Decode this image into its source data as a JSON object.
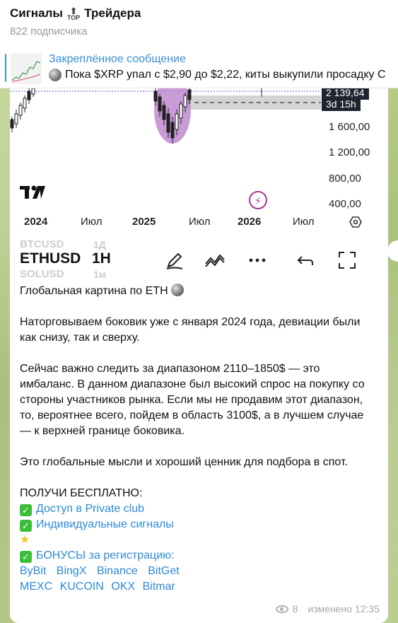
{
  "header": {
    "title_before": "Сигналы",
    "top_label": "TOP",
    "title_after": "Трейдера",
    "subscribers": "822 подписчика"
  },
  "pinned": {
    "title": "Закреплённое сообщение",
    "text": "Пока $XRP упал с $2,90 до $2,22, киты выкупили просадку  С"
  },
  "chart": {
    "price_current": "2 139,64",
    "price_countdown": "3d 15h",
    "price_labels": [
      "1 600,00",
      "1 200,00",
      "800,00",
      "400,00"
    ],
    "x_labels": [
      "2024",
      "Июл",
      "2025",
      "Июл",
      "2026",
      "Июл"
    ],
    "logo": "TV"
  },
  "toolbar": {
    "ghost_top": "BTCUSD",
    "ghost_top_tf": "1Д",
    "symbol": "ETHUSD",
    "timeframe": "1H",
    "ghost_bottom": "SOLUSD",
    "ghost_bottom_tf": "1м",
    "icons": [
      "pen-icon",
      "trend-icon",
      "more-icon",
      "undo-icon",
      "fullscreen-icon"
    ]
  },
  "post": {
    "heading": "Глобальная картина по ETH",
    "p1": "Наторговываем боковик уже с января 2024 года, девиации были как снизу, так и сверху.",
    "p2": "Сейчас важно следить за диапазоном 2110–1850$ — это имбаланс. В данном диапазоне был высокий спрос на покупку со стороны участников рынка. Если мы не продавим этот диапазон, то, вероятнее всего, пойдем в область 3100$, а в лучшем случае — к верхней границе боковика.",
    "p3": "Это глобальные мысли и хороший ценник для подбора в спот.",
    "cta": "ПОЛУЧИ БЕСПЛАТНО:",
    "link1": "Доступ в Private club",
    "link2": "Индивидуальные сигналы",
    "link3": "БОНУСЫ за регистрацию:",
    "exchanges_row1": [
      "ByBit",
      "BingX",
      "Binance",
      "BitGet"
    ],
    "exchanges_row2": [
      "MEXC",
      "KUCOIN",
      "OKX",
      "Bitmar"
    ]
  },
  "meta": {
    "views": "8",
    "edited": "изменено 12:35"
  },
  "colors": {
    "accent": "#3a8fd6",
    "link": "#2d8ad6",
    "check": "#3bbf3b",
    "highlight": "#c08ad0"
  }
}
